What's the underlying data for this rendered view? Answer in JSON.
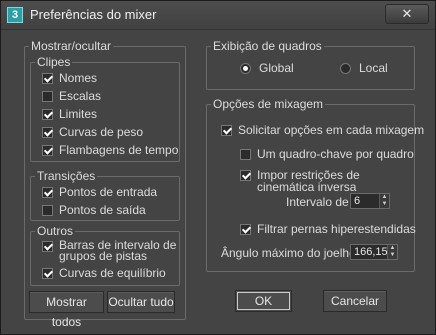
{
  "window": {
    "title": "Preferências do mixer",
    "app_icon": "3ds-max-icon",
    "close_icon": "close-icon",
    "close_glyph": "✕"
  },
  "show_hide": {
    "title": "Mostrar/ocultar",
    "clips": {
      "title": "Clipes",
      "items": [
        {
          "label": "Nomes",
          "checked": true
        },
        {
          "label": "Escalas",
          "checked": false
        },
        {
          "label": "Limites",
          "checked": true
        },
        {
          "label": "Curvas de peso",
          "checked": true
        },
        {
          "label": "Flambagens de tempo",
          "checked": true
        }
      ]
    },
    "transitions": {
      "title": "Transições",
      "items": [
        {
          "label": "Pontos de entrada",
          "checked": true
        },
        {
          "label": "Pontos de saída",
          "checked": false
        }
      ]
    },
    "others": {
      "title": "Outros",
      "items": [
        {
          "label": "Barras de intervalo de grupos de pistas",
          "checked": true
        },
        {
          "label": "Curvas de equilíbrio",
          "checked": true
        }
      ]
    },
    "show_all_label": "Mostrar todos",
    "hide_all_label": "Ocultar tudo"
  },
  "frame_display": {
    "title": "Exibição de quadros",
    "options": [
      {
        "label": "Global",
        "selected": true
      },
      {
        "label": "Local",
        "selected": false
      }
    ]
  },
  "mix_options": {
    "title": "Opções de mixagem",
    "prompt_label": "Solicitar opções em cada mixagem",
    "prompt_checked": true,
    "keyframe_label": "Um quadro-chave por quadro",
    "keyframe_checked": false,
    "ik_label": "Impor restrições de cinemática inversa",
    "ik_checked": true,
    "interval_label": "Intervalo de",
    "interval_value": "6",
    "filter_label": "Filtrar pernas hiperestendidas",
    "filter_checked": true,
    "knee_label": "Ângulo máximo do joelho",
    "knee_value": "166,15"
  },
  "footer": {
    "ok_label": "OK",
    "cancel_label": "Cancelar"
  }
}
